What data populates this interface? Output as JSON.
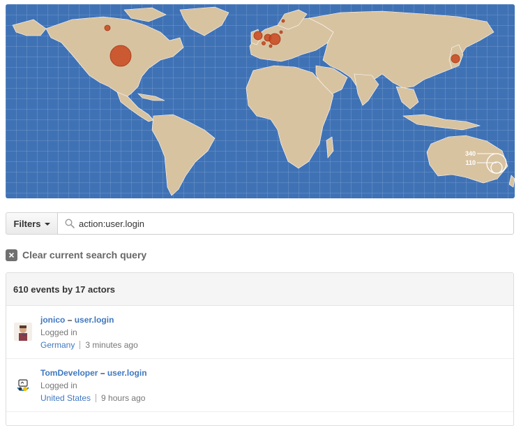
{
  "map": {
    "legend_values": [
      "340",
      "110"
    ],
    "colors": {
      "ocean": "#3f72b5",
      "land": "#d8c3a1",
      "bubble": "#c9471f"
    }
  },
  "filters": {
    "button_label": "Filters",
    "search_value": "action:user.login",
    "search_icon": "search-icon"
  },
  "clear_query": {
    "label": "Clear current search query",
    "icon": "close-icon"
  },
  "results": {
    "summary": "610 events by 17 actors",
    "events": [
      {
        "actor": "jonico",
        "separator": "–",
        "action": "user.login",
        "description": "Logged in",
        "country": "Germany",
        "time": "3 minutes ago"
      },
      {
        "actor": "TomDeveloper",
        "separator": "–",
        "action": "user.login",
        "description": "Logged in",
        "country": "United States",
        "time": "9 hours ago"
      }
    ]
  }
}
